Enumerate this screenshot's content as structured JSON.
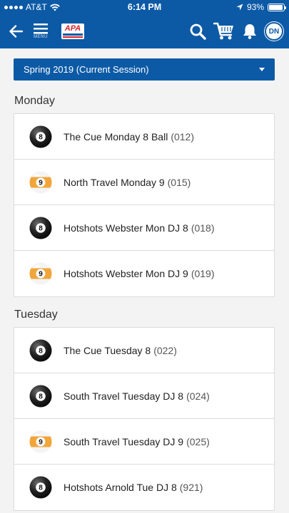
{
  "status_bar": {
    "carrier": "AT&T",
    "time": "6:14 PM",
    "battery": "93%",
    "battery_level": 0.93
  },
  "nav": {
    "menu_label": "MENU",
    "logo_text": "APA",
    "avatar_initials": "DN"
  },
  "session": {
    "selected": "Spring 2019 (Current Session)"
  },
  "colors": {
    "primary": "#0c5aa6",
    "eight_ball": "#1a1a1a",
    "nine_ball": "#f2a53a"
  },
  "days": [
    {
      "label": "Monday",
      "teams": [
        {
          "name": "The Cue Monday 8 Ball",
          "code": "(012)",
          "ball": "8",
          "icon": "eight-ball-icon"
        },
        {
          "name": "North Travel Monday 9",
          "code": "(015)",
          "ball": "9",
          "icon": "nine-ball-icon"
        },
        {
          "name": "Hotshots Webster Mon DJ 8",
          "code": "(018)",
          "ball": "8",
          "icon": "eight-ball-icon"
        },
        {
          "name": "Hotshots Webster Mon DJ 9",
          "code": "(019)",
          "ball": "9",
          "icon": "nine-ball-icon"
        }
      ]
    },
    {
      "label": "Tuesday",
      "teams": [
        {
          "name": "The Cue Tuesday 8",
          "code": "(022)",
          "ball": "8",
          "icon": "eight-ball-icon"
        },
        {
          "name": "South Travel Tuesday DJ 8",
          "code": "(024)",
          "ball": "8",
          "icon": "eight-ball-icon"
        },
        {
          "name": "South Travel Tuesday DJ 9",
          "code": "(025)",
          "ball": "9",
          "icon": "nine-ball-icon"
        },
        {
          "name": "Hotshots Arnold Tue DJ 8",
          "code": "(921)",
          "ball": "8",
          "icon": "eight-ball-icon"
        }
      ]
    }
  ]
}
